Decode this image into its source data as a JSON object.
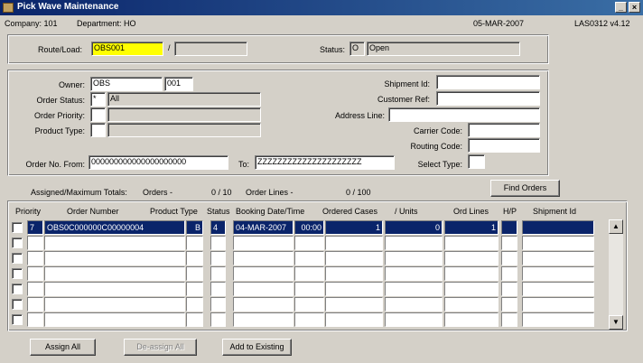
{
  "window": {
    "title": "Pick Wave Maintenance",
    "minimize": "_",
    "close": "×"
  },
  "info": {
    "company": "Company: 101",
    "department": "Department: HO",
    "date": "05-MAR-2007",
    "version": "LAS0312 v4.12"
  },
  "route": {
    "label": "Route/Load:",
    "value": "OBS001",
    "separator": "/",
    "load_value": "",
    "status_label": "Status:",
    "status_code": "O",
    "status_text": "Open"
  },
  "filters": {
    "owner_label": "Owner:",
    "owner_value": "OBS",
    "owner_code": "001",
    "order_status_label": "Order Status:",
    "order_status_code": "*",
    "order_status_text": "All",
    "order_priority_label": "Order Priority:",
    "product_type_label": "Product Type:",
    "shipment_id_label": "Shipment Id:",
    "customer_ref_label": "Customer Ref:",
    "address_line_label": "Address Line:",
    "carrier_code_label": "Carrier Code:",
    "routing_code_label": "Routing Code:",
    "select_type_label": "Select Type:",
    "order_no_from_label": "Order No. From:",
    "order_no_from_value": "000000000000000000000",
    "to_label": "To:",
    "order_no_to_value": "ZZZZZZZZZZZZZZZZZZZZZ"
  },
  "totals": {
    "label": "Assigned/Maximum Totals:",
    "orders_label": "Orders -",
    "orders_value": "0 / 10",
    "order_lines_label": "Order Lines -",
    "order_lines_value": "0 / 100"
  },
  "buttons": {
    "find_orders": "Find Orders",
    "assign_all": "Assign All",
    "deassign_all": "De-assign All",
    "add_to_existing": "Add to Existing"
  },
  "table": {
    "headers": {
      "priority": "Priority",
      "order_number": "Order Number",
      "product_type": "Product Type",
      "status": "Status",
      "booking": "Booking Date/Time",
      "ordered_cases": "Ordered Cases",
      "units": "/ Units",
      "ord_lines": "Ord Lines",
      "hp": "H/P",
      "shipment_id": "Shipment Id"
    },
    "row1": {
      "priority": "7",
      "order_number": "OBS0C000000C00000004",
      "product_type": "B",
      "status": "4",
      "booking_date": "04-MAR-2007",
      "booking_time": "00:00",
      "ordered_cases": "1",
      "units": "0",
      "ord_lines": "1"
    }
  }
}
